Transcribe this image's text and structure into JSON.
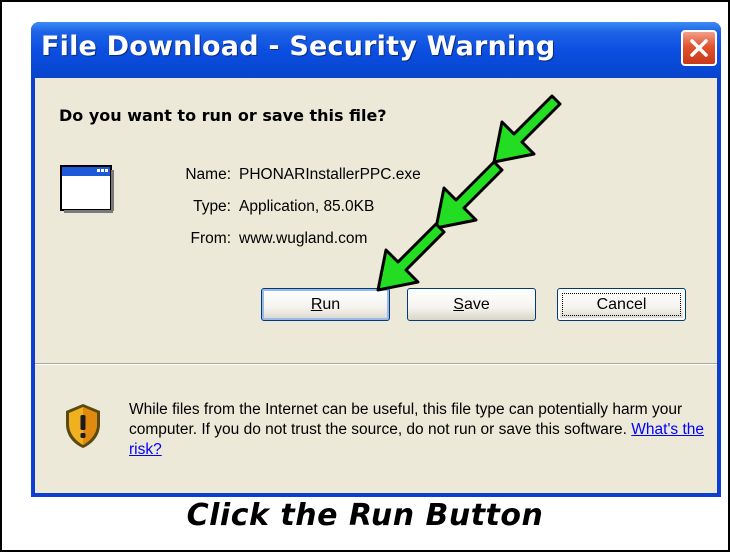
{
  "dialog": {
    "title": "File Download - Security Warning",
    "question": "Do you want to run or save this file?",
    "file": {
      "name_label": "Name:",
      "name_value": "PHONARInstallerPPC.exe",
      "type_label": "Type:",
      "type_value": "Application, 85.0KB",
      "from_label": "From:",
      "from_value": "www.wugland.com"
    },
    "buttons": {
      "run_first": "R",
      "run_rest": "un",
      "save_first": "S",
      "save_rest": "ave",
      "cancel": "Cancel"
    },
    "warning": {
      "text": "While files from the Internet can be useful, this file type can potentially harm your computer. If you do not trust the source, do not run or save this software.",
      "link": "What's the risk?"
    }
  },
  "caption": "Click the Run Button",
  "colors": {
    "title_bar": "#0a4de0",
    "dialog_body": "#ece9d8",
    "arrow_fill": "#22dd22",
    "close_button": "#e0542e"
  }
}
